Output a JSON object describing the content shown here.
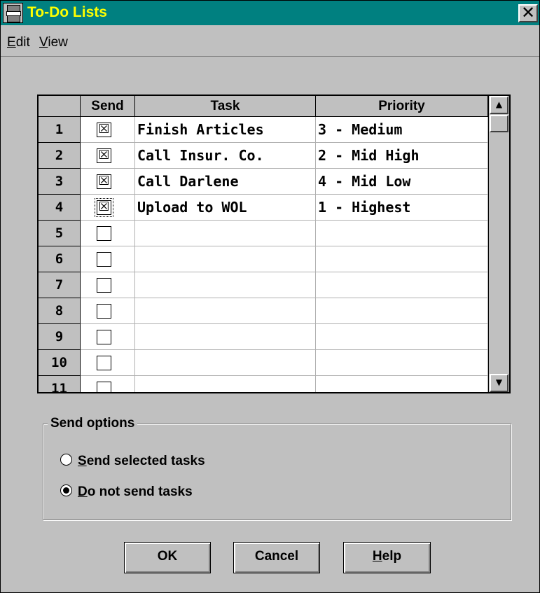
{
  "window": {
    "title": "To-Do Lists",
    "close_glyph": "✕"
  },
  "menu": {
    "items": [
      {
        "prefix": "E",
        "rest": "dit"
      },
      {
        "prefix": "V",
        "rest": "iew"
      }
    ]
  },
  "grid": {
    "headers": [
      "Send",
      "Task",
      "Priority"
    ],
    "rows": [
      {
        "num": "1",
        "checked": true,
        "task": "Finish Articles",
        "priority": "3 - Medium"
      },
      {
        "num": "2",
        "checked": true,
        "task": "Call Insur. Co.",
        "priority": "2 - Mid High"
      },
      {
        "num": "3",
        "checked": true,
        "task": "Call Darlene",
        "priority": "4 - Mid Low"
      },
      {
        "num": "4",
        "checked": true,
        "task": "Upload to WOL",
        "priority": "1 - Highest"
      },
      {
        "num": "5",
        "checked": false,
        "task": "",
        "priority": ""
      },
      {
        "num": "6",
        "checked": false,
        "task": "",
        "priority": ""
      },
      {
        "num": "7",
        "checked": false,
        "task": "",
        "priority": ""
      },
      {
        "num": "8",
        "checked": false,
        "task": "",
        "priority": ""
      },
      {
        "num": "9",
        "checked": false,
        "task": "",
        "priority": ""
      },
      {
        "num": "10",
        "checked": false,
        "task": "",
        "priority": ""
      },
      {
        "num": "11",
        "checked": false,
        "task": "",
        "priority": ""
      }
    ],
    "check_glyph": "☒",
    "scroll_up": "▲",
    "scroll_down": "▼"
  },
  "send_options": {
    "label": "Send options",
    "options": [
      {
        "accel": "S",
        "rest": "end selected tasks",
        "selected": false
      },
      {
        "accel": "D",
        "rest": "o not send tasks",
        "selected": true
      }
    ]
  },
  "buttons": {
    "ok": "OK",
    "cancel": "Cancel",
    "help_accel": "H",
    "help_rest": "elp"
  }
}
